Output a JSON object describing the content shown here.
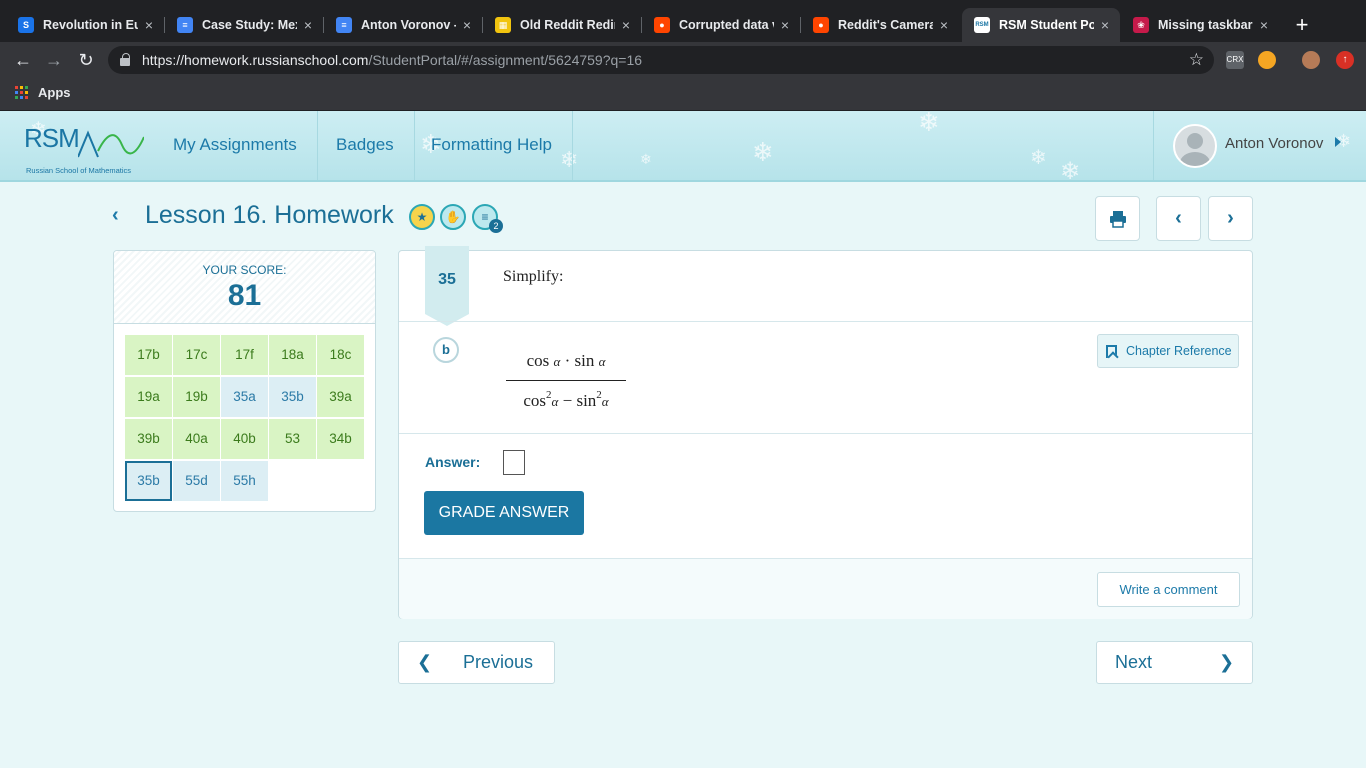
{
  "browser": {
    "tabs": [
      {
        "title": "Revolution in Eur",
        "icon_color": "#1a73e8",
        "icon": "S"
      },
      {
        "title": "Case Study: Mex",
        "icon_color": "#4285f4",
        "icon": "≡"
      },
      {
        "title": "Anton Voronov -",
        "icon_color": "#4285f4",
        "icon": "≡"
      },
      {
        "title": "Old Reddit Redir",
        "icon_color": "#f1c40f",
        "icon": "▦"
      },
      {
        "title": "Corrupted data v",
        "icon_color": "#ff4500",
        "icon": "●"
      },
      {
        "title": "Reddit's Camera",
        "icon_color": "#ff4500",
        "icon": "●"
      },
      {
        "title": "RSM Student Po",
        "icon_color": "#1b76a4",
        "icon": "RSM"
      },
      {
        "title": "Missing taskbar",
        "icon_color": "#c51a4a",
        "icon": "❀"
      }
    ],
    "active_tab": 6,
    "close_glyph": "×",
    "new_tab_glyph": "+",
    "url_host": "https://homework.russianschool.com",
    "url_path": "/StudentPortal/#/assignment/5624759?q=16",
    "bookmark_apps_label": "Apps",
    "ext_crx": "CRX"
  },
  "header": {
    "logo_text": "RSM",
    "logo_subtitle": "Russian School of Mathematics",
    "nav": [
      "My Assignments",
      "Badges",
      "Formatting Help"
    ],
    "user_name": "Anton Voronov"
  },
  "lesson": {
    "title": "Lesson 16. Homework",
    "badge_count": "2"
  },
  "score": {
    "label": "YOUR SCORE:",
    "value": "81",
    "problems": [
      {
        "label": "17b",
        "state": "correct"
      },
      {
        "label": "17c",
        "state": "correct"
      },
      {
        "label": "17f",
        "state": "correct"
      },
      {
        "label": "18a",
        "state": "correct"
      },
      {
        "label": "18c",
        "state": "correct"
      },
      {
        "label": "19a",
        "state": "correct"
      },
      {
        "label": "19b",
        "state": "correct"
      },
      {
        "label": "35a",
        "state": "pending"
      },
      {
        "label": "35b",
        "state": "pending"
      },
      {
        "label": "39a",
        "state": "correct"
      },
      {
        "label": "39b",
        "state": "correct"
      },
      {
        "label": "40a",
        "state": "correct"
      },
      {
        "label": "40b",
        "state": "correct"
      },
      {
        "label": "53",
        "state": "correct"
      },
      {
        "label": "34b",
        "state": "correct"
      },
      {
        "label": "35b",
        "state": "selected"
      },
      {
        "label": "55d",
        "state": "pending"
      },
      {
        "label": "55h",
        "state": "pending"
      }
    ]
  },
  "question": {
    "number": "35",
    "prompt": "Simplify:",
    "part": "b",
    "numerator": {
      "a": "cos",
      "b": "α",
      "dot": "·",
      "c": "sin",
      "d": "α"
    },
    "denominator": {
      "a": "cos",
      "sup1": "2",
      "b": "α",
      "minus": "−",
      "c": "sin",
      "sup2": "2",
      "d": "α"
    },
    "chapter_reference": "Chapter Reference",
    "answer_label": "Answer:",
    "grade_button": "GRADE ANSWER",
    "comment_button": "Write a comment"
  },
  "navigation": {
    "previous": "Previous",
    "next": "Next"
  },
  "colors": {
    "accent": "#1b77a2",
    "correct_bg": "#d9f4c4",
    "pending_bg": "#dceef4"
  }
}
